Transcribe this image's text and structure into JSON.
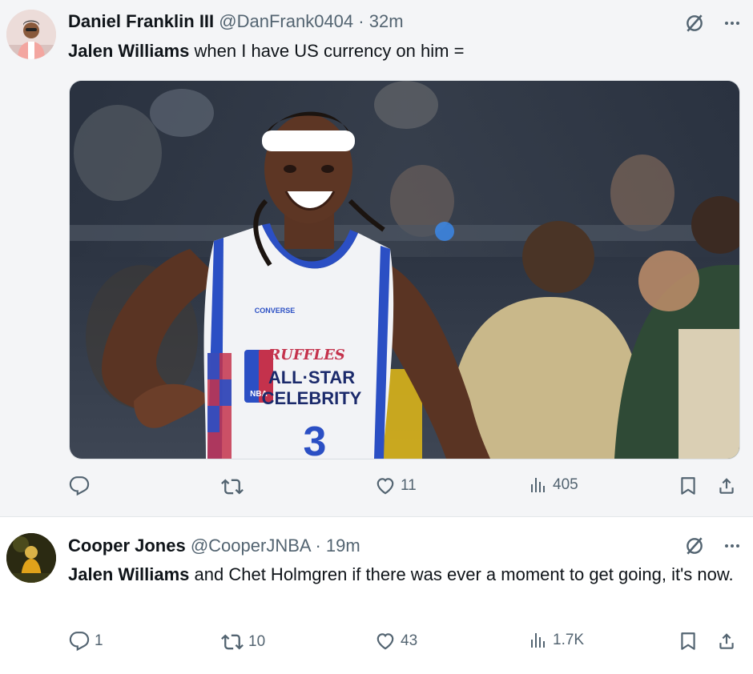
{
  "tweets": [
    {
      "display_name": "Daniel Franklin III",
      "handle": "@DanFrank0404",
      "separator": "·",
      "time": "32m",
      "mention": "Jalen Williams",
      "text": " when I have US currency on him =",
      "media": {
        "jersey_brand": "CONVERSE",
        "jersey_sponsor": "RUFFLES",
        "jersey_text_line1": "ALL·STAR",
        "jersey_text_line2": "CELEBRITY",
        "jersey_logo": "NBA",
        "jersey_number": "3"
      },
      "actions": {
        "replies": "",
        "retweets": "",
        "likes": "11",
        "views": "405"
      }
    },
    {
      "display_name": "Cooper Jones",
      "handle": "@CooperJNBA",
      "separator": "·",
      "time": "19m",
      "mention": "Jalen Williams",
      "text": " and Chet Holmgren if there was ever a moment to get going, it's now.",
      "actions": {
        "replies": "1",
        "retweets": "10",
        "likes": "43",
        "views": "1.7K"
      }
    }
  ],
  "icons": {
    "grok": "grok-slash-icon",
    "more": "more-dots-icon",
    "reply": "reply-bubble-icon",
    "retweet": "retweet-icon",
    "like": "heart-icon",
    "views": "bar-chart-icon",
    "bookmark": "bookmark-icon",
    "share": "share-upload-icon"
  },
  "colors": {
    "text_primary": "#0f1419",
    "text_secondary": "#536471",
    "background_tweet1": "#f4f5f7",
    "background_tweet2": "#ffffff"
  }
}
